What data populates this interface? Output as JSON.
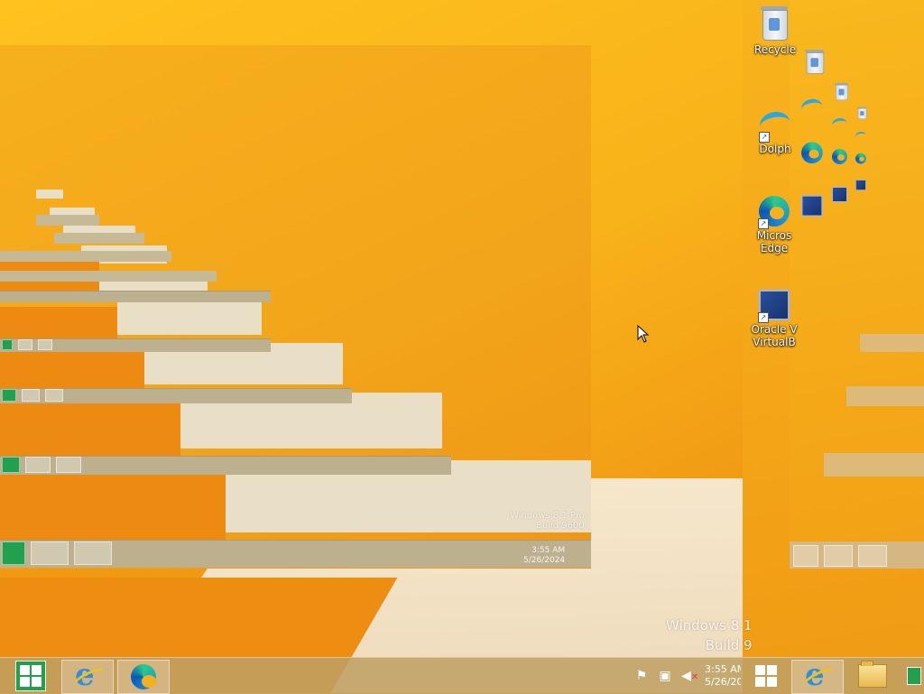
{
  "desktop": {
    "icons": [
      {
        "name": "Recycle Bin",
        "label": "Recycle"
      },
      {
        "name": "Dolphin",
        "label": "Dolph"
      },
      {
        "name": "Microsoft Edge",
        "label": "Micros Edge"
      },
      {
        "name": "Oracle VM VirtualBox",
        "label": "Oracle V VirtualB"
      }
    ],
    "watermark": {
      "line1": "Windows 8.1",
      "line2": "Build 9"
    },
    "ghost_watermark": {
      "line1": "Windows 8.1 Pro",
      "line2": "Build 9600"
    }
  },
  "taskbar": {
    "start_label": "Start",
    "pinned": [
      {
        "name": "Internet Explorer",
        "icon": "internet-explorer-icon"
      },
      {
        "name": "Microsoft Edge",
        "icon": "edge-icon"
      }
    ],
    "tray": {
      "icons": [
        "flag-icon",
        "network-icon",
        "volume-muted-icon"
      ],
      "time": "3:55 AM",
      "date": "5/26/20"
    }
  },
  "right_taskbar": {
    "pinned": [
      {
        "name": "Start",
        "icon": "windows-logo-icon"
      },
      {
        "name": "Internet Explorer",
        "icon": "internet-explorer-icon"
      },
      {
        "name": "File Explorer",
        "icon": "folder-icon"
      }
    ]
  },
  "ghost_clock": {
    "time": "3:55 AM",
    "date": "5/26/2024"
  },
  "colors": {
    "wallpaper": "#f4a81a",
    "start_green": "#21a150",
    "taskbar": "#bea064"
  }
}
